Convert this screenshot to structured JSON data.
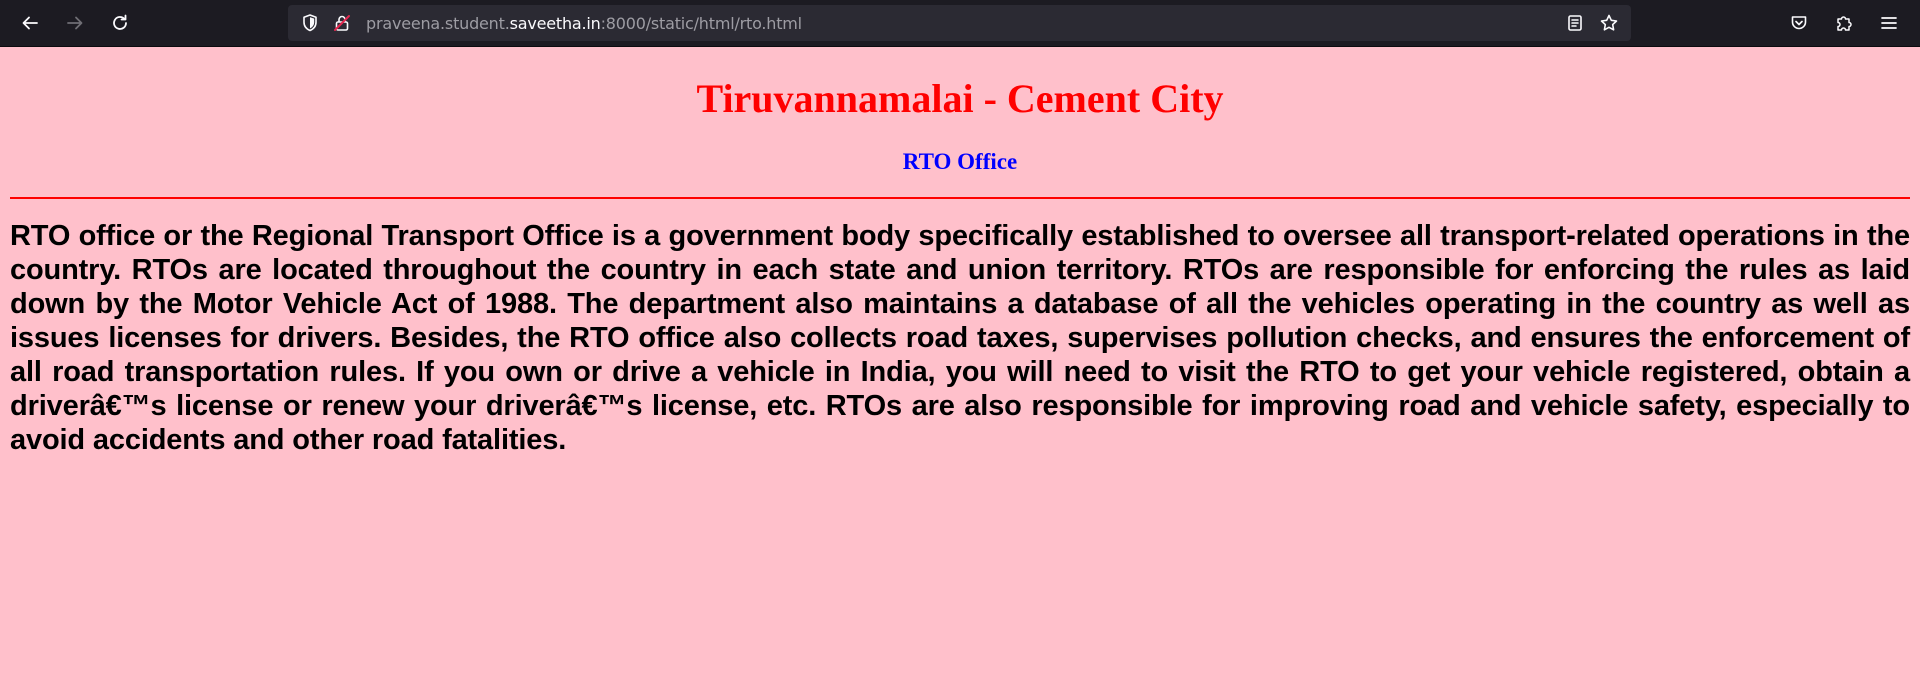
{
  "browser": {
    "url_prefix": "praveena.student.",
    "url_domain": "saveetha.in",
    "url_suffix": ":8000/static/html/rto.html"
  },
  "page": {
    "title": "Tiruvannamalai - Cement City",
    "subtitle": "RTO Office",
    "paragraph": "RTO office or the Regional Transport Office is a government body specifically established to oversee all transport-related operations in the country. RTOs are located throughout the country in each state and union territory. RTOs are responsible for enforcing the rules as laid down by the Motor Vehicle Act of 1988. The department also maintains a database of all the vehicles operating in the country as well as issues licenses for drivers. Besides, the RTO office also collects road taxes, supervises pollution checks, and ensures the enforcement of all road transportation rules. If you own or drive a vehicle in India, you will need to visit the RTO to get your vehicle registered, obtain a driverâ€™s license or renew your driverâ€™s license, etc. RTOs are also responsible for improving road and vehicle safety, especially to avoid accidents and other road fatalities."
  },
  "icons": {
    "back": "back-arrow-icon",
    "forward": "forward-arrow-icon",
    "reload": "reload-icon",
    "shield": "tracking-protection-shield-icon",
    "insecure": "insecure-lock-icon",
    "reader": "reader-view-icon",
    "bookmark": "bookmark-star-icon",
    "pocket": "pocket-icon",
    "extensions": "extensions-puzzle-icon",
    "menu": "hamburger-menu-icon"
  },
  "colors": {
    "page_background": "#ffc0cb",
    "title": "#ff0000",
    "subtitle": "#0000ff",
    "rule": "#ff0000",
    "toolbar": "#1c1b22",
    "urlbar": "#2b2a33"
  }
}
